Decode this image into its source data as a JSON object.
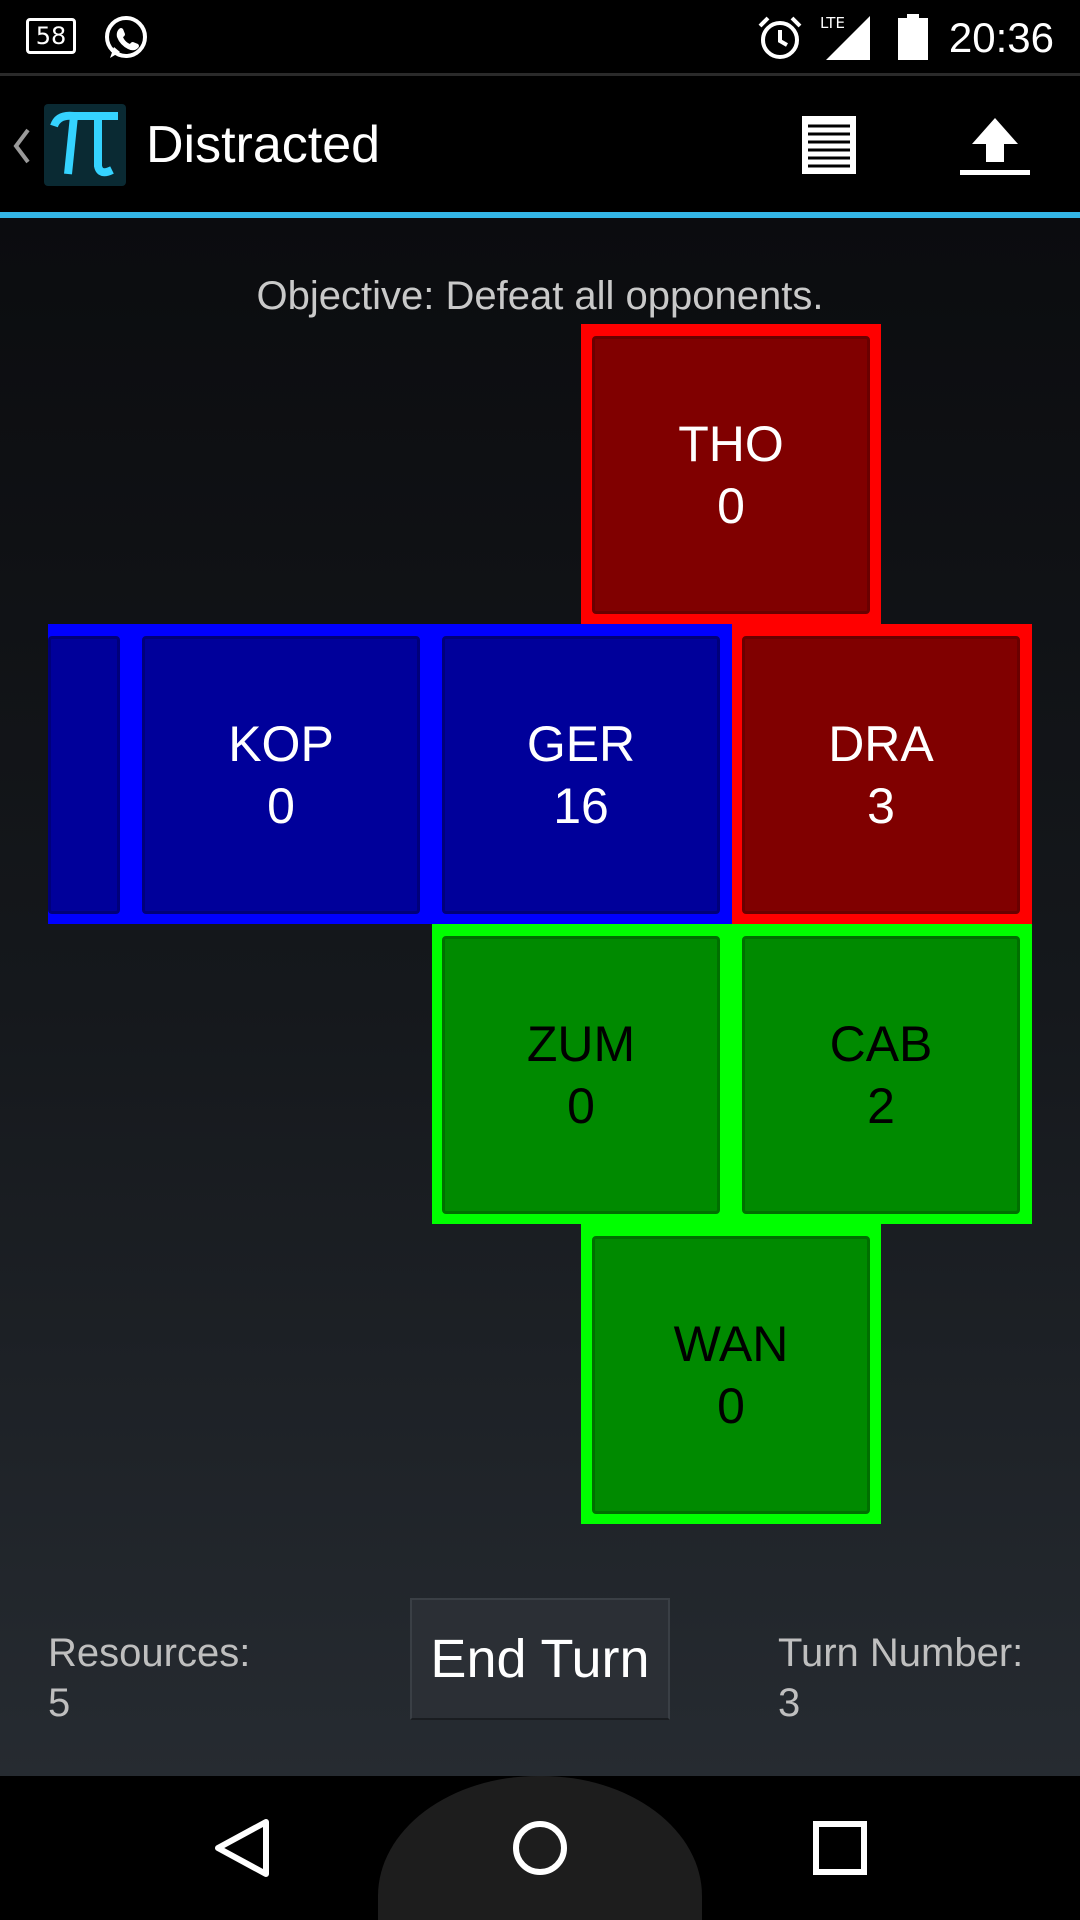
{
  "status_bar": {
    "notification_count": "58",
    "time": "20:36",
    "lte": "LTE",
    "icons": [
      "notification-badge-icon",
      "whatsapp-icon",
      "alarm-icon",
      "lte-signal-icon",
      "battery-icon"
    ]
  },
  "action_bar": {
    "title": "Distracted",
    "icons": [
      "up-caret-icon",
      "pi-app-icon",
      "list-icon",
      "upload-icon"
    ]
  },
  "game": {
    "objective": "Objective: Defeat all opponents.",
    "tiles": {
      "tho": {
        "name": "THO",
        "value": "0",
        "team": "red"
      },
      "kop": {
        "name": "KOP",
        "value": "0",
        "team": "blue"
      },
      "ger": {
        "name": "GER",
        "value": "16",
        "team": "blue"
      },
      "dra": {
        "name": "DRA",
        "value": "3",
        "team": "red"
      },
      "zum": {
        "name": "ZUM",
        "value": "0",
        "team": "green"
      },
      "cab": {
        "name": "CAB",
        "value": "2",
        "team": "green"
      },
      "wan": {
        "name": "WAN",
        "value": "0",
        "team": "green"
      }
    },
    "team_colors": {
      "red": "#ff0000",
      "blue": "#0000ff",
      "green": "#00ff00"
    }
  },
  "footer": {
    "resources_label": "Resources:",
    "resources_value": "5",
    "end_turn_label": "End Turn",
    "turn_label": "Turn Number:",
    "turn_value": "3"
  },
  "nav_bar": {
    "icons": [
      "back-icon",
      "home-icon",
      "recents-icon"
    ]
  }
}
